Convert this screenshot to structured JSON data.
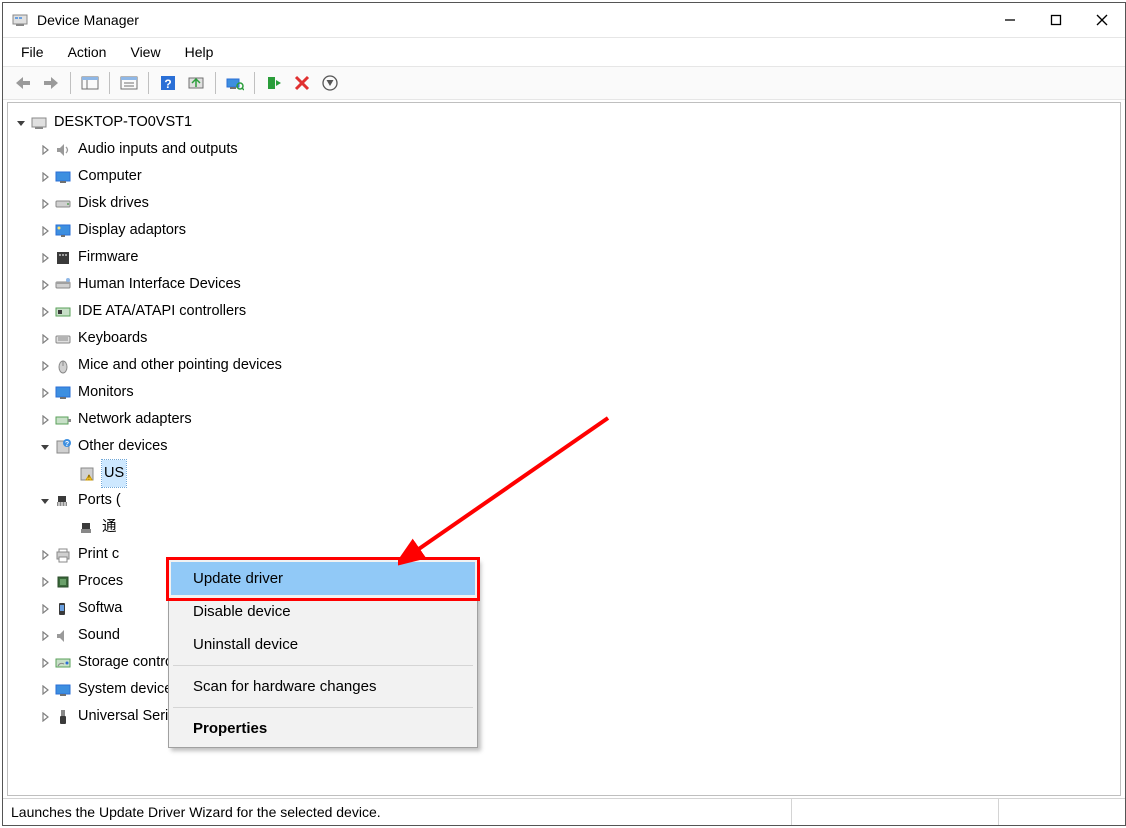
{
  "title": "Device Manager",
  "menubar": {
    "file": "File",
    "action": "Action",
    "view": "View",
    "help": "Help"
  },
  "tree": {
    "root": "DESKTOP-TO0VST1",
    "cats": [
      {
        "expanded": false,
        "icon": "audio",
        "label": "Audio inputs and outputs",
        "children": []
      },
      {
        "expanded": false,
        "icon": "computer",
        "label": "Computer",
        "children": []
      },
      {
        "expanded": false,
        "icon": "disk",
        "label": "Disk drives",
        "children": []
      },
      {
        "expanded": false,
        "icon": "display",
        "label": "Display adaptors",
        "children": []
      },
      {
        "expanded": false,
        "icon": "firmware",
        "label": "Firmware",
        "children": []
      },
      {
        "expanded": false,
        "icon": "hid",
        "label": "Human Interface Devices",
        "children": []
      },
      {
        "expanded": false,
        "icon": "ide",
        "label": "IDE ATA/ATAPI controllers",
        "children": []
      },
      {
        "expanded": false,
        "icon": "keyboard",
        "label": "Keyboards",
        "children": []
      },
      {
        "expanded": false,
        "icon": "mouse",
        "label": "Mice and other pointing devices",
        "children": []
      },
      {
        "expanded": false,
        "icon": "monitor",
        "label": "Monitors",
        "children": []
      },
      {
        "expanded": false,
        "icon": "network",
        "label": "Network adapters",
        "children": []
      },
      {
        "expanded": true,
        "icon": "other",
        "label": "Other devices",
        "children": [
          {
            "icon": "unknown",
            "label": "US",
            "selected": true
          }
        ]
      },
      {
        "expanded": true,
        "icon": "ports",
        "label": "Ports (",
        "children": [
          {
            "icon": "port",
            "label": "通",
            "selected": false
          }
        ]
      },
      {
        "expanded": false,
        "icon": "printer",
        "label": "Print c",
        "children": []
      },
      {
        "expanded": false,
        "icon": "processor",
        "label": "Proces",
        "children": []
      },
      {
        "expanded": false,
        "icon": "software",
        "label": "Softwa",
        "children": []
      },
      {
        "expanded": false,
        "icon": "sound",
        "label": "Sound",
        "children": []
      },
      {
        "expanded": false,
        "icon": "storage",
        "label": "Storage controllers",
        "children": []
      },
      {
        "expanded": false,
        "icon": "system",
        "label": "System devices",
        "children": []
      },
      {
        "expanded": false,
        "icon": "usb",
        "label": "Universal Serial Bus controllers",
        "children": []
      }
    ]
  },
  "context_menu": {
    "items": [
      {
        "label": "Update driver",
        "highlighted": true
      },
      {
        "label": "Disable device"
      },
      {
        "label": "Uninstall device"
      },
      {
        "sep": true
      },
      {
        "label": "Scan for hardware changes"
      },
      {
        "sep": true
      },
      {
        "label": "Properties",
        "bold": true
      }
    ]
  },
  "statusbar": "Launches the Update Driver Wizard for the selected device."
}
